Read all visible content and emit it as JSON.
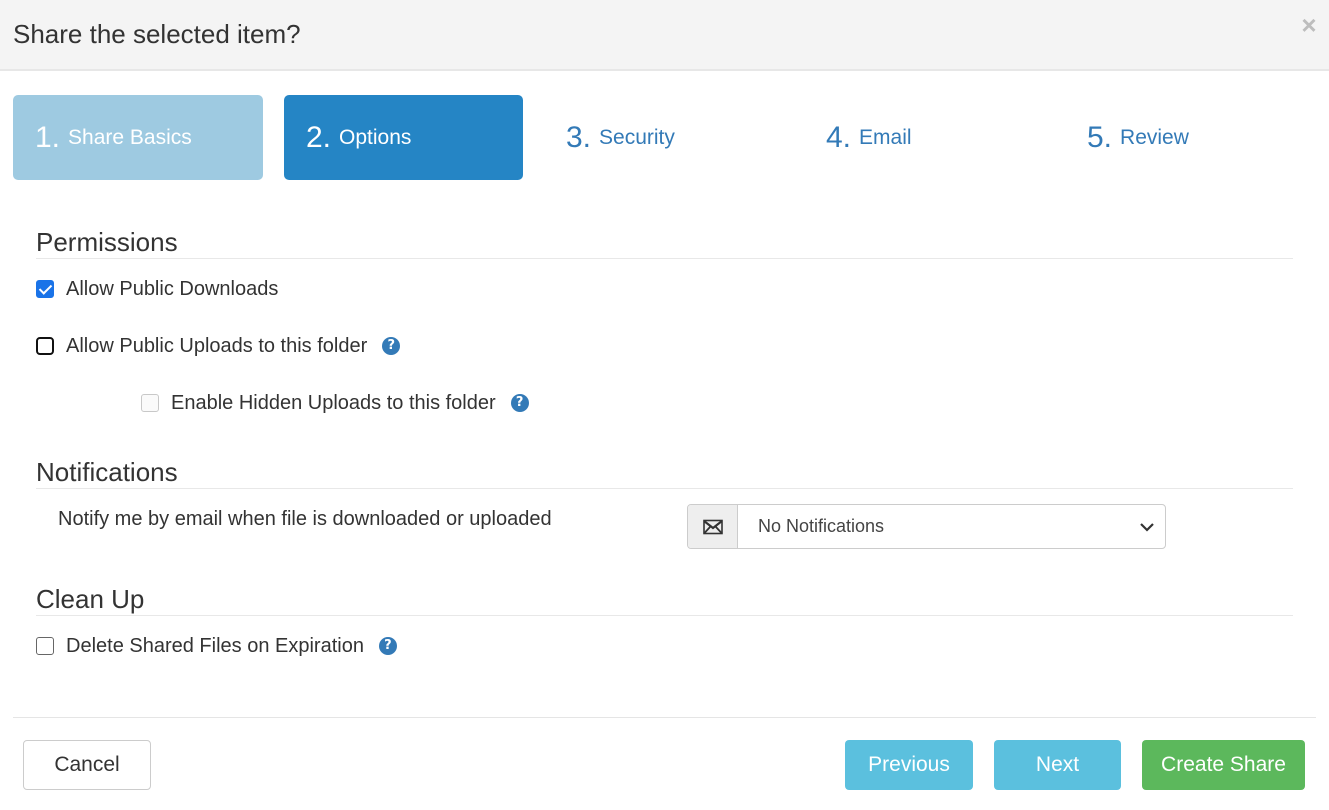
{
  "dialog": {
    "title": "Share the selected item?",
    "close_label": "×"
  },
  "wizard": {
    "steps": [
      {
        "num": "1.",
        "label": "Share Basics",
        "state": "completed"
      },
      {
        "num": "2.",
        "label": "Options",
        "state": "active"
      },
      {
        "num": "3.",
        "label": "Security",
        "state": "pending"
      },
      {
        "num": "4.",
        "label": "Email",
        "state": "pending"
      },
      {
        "num": "5.",
        "label": "Review",
        "state": "pending"
      }
    ]
  },
  "permissions": {
    "title": "Permissions",
    "allow_downloads": {
      "label": "Allow Public Downloads",
      "checked": true
    },
    "allow_uploads": {
      "label": "Allow Public Uploads to this folder",
      "checked": false
    },
    "hidden_uploads": {
      "label": "Enable Hidden Uploads to this folder",
      "checked": false,
      "disabled": true
    },
    "help_glyph": "?"
  },
  "notifications": {
    "title": "Notifications",
    "label": "Notify me by email when file is downloaded or uploaded",
    "selected": "No Notifications",
    "icon": "envelope-icon"
  },
  "cleanup": {
    "title": "Clean Up",
    "delete_on_expiration": {
      "label": "Delete Shared Files on Expiration",
      "checked": false
    }
  },
  "footer": {
    "cancel": "Cancel",
    "previous": "Previous",
    "next": "Next",
    "create": "Create Share"
  },
  "colors": {
    "step_completed": "#9ecae1",
    "step_active": "#2585c5",
    "step_pending_text": "#337ab7",
    "info_button": "#5bc0de",
    "success_button": "#5cb85c",
    "checkbox_checked": "#1a73e8",
    "help_icon": "#337ab7"
  }
}
